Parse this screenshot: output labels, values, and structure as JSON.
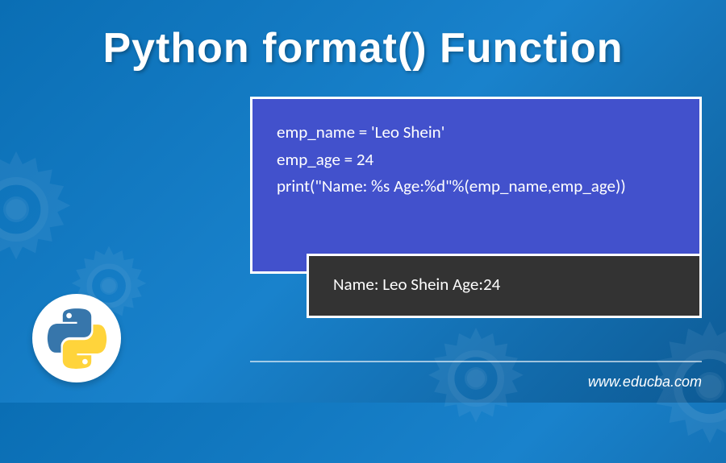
{
  "title": "Python format() Function",
  "code": {
    "line1": "emp_name = 'Leo Shein'",
    "line2": "emp_age = 24",
    "line3": "print(\"Name: %s Age:%d\"%(emp_name,emp_age))"
  },
  "output": "Name: Leo Shein Age:24",
  "website": "www.educba.com",
  "icons": {
    "gear": "gear-icon",
    "python": "python-logo"
  }
}
